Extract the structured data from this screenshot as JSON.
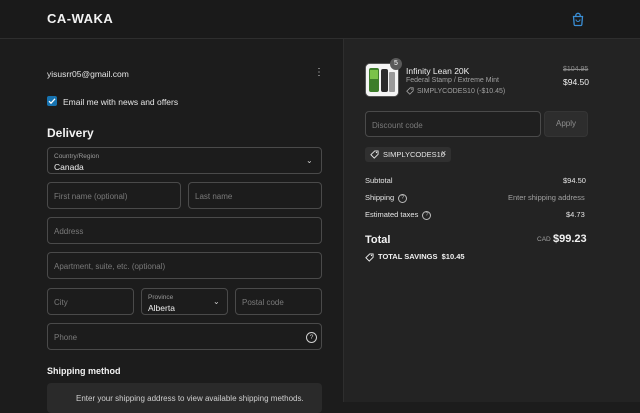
{
  "header": {
    "brand": "CA-WAKA",
    "cart_icon": "shopping-bag-icon"
  },
  "contact": {
    "email": "yisusrr05@gmail.com",
    "menu_icon": "kebab-icon",
    "newsletter_label": "Email me with news and offers",
    "newsletter_checked": true
  },
  "delivery": {
    "heading": "Delivery",
    "country_label": "Country/Region",
    "country_value": "Canada",
    "first_name_placeholder": "First name (optional)",
    "last_name_placeholder": "Last name",
    "address_placeholder": "Address",
    "apartment_placeholder": "Apartment, suite, etc. (optional)",
    "city_placeholder": "City",
    "province_label": "Province",
    "province_value": "Alberta",
    "postal_placeholder": "Postal code",
    "phone_placeholder": "Phone"
  },
  "shipping": {
    "heading": "Shipping method",
    "message": "Enter your shipping address to view available shipping methods."
  },
  "order": {
    "product": {
      "quantity": "5",
      "name": "Infinity Lean 20K",
      "variant": "Federal Stamp / Extreme Mint",
      "discount_code": "SIMPLYCODES10 (-$10.45)",
      "original_price": "$104.95",
      "price": "$94.50"
    },
    "discount_placeholder": "Discount code",
    "apply_label": "Apply",
    "applied_code": "SIMPLYCODES10",
    "subtotal_label": "Subtotal",
    "subtotal_value": "$94.50",
    "shipping_label": "Shipping",
    "shipping_value": "Enter shipping address",
    "taxes_label": "Estimated taxes",
    "taxes_value": "$4.73",
    "total_label": "Total",
    "currency": "CAD",
    "total_value": "$99.23",
    "savings_label": "TOTAL SAVINGS",
    "savings_value": "$10.45"
  },
  "colors": {
    "accent": "#1773b0",
    "background": "#1c1c1c",
    "summary_bg": "#232323"
  }
}
